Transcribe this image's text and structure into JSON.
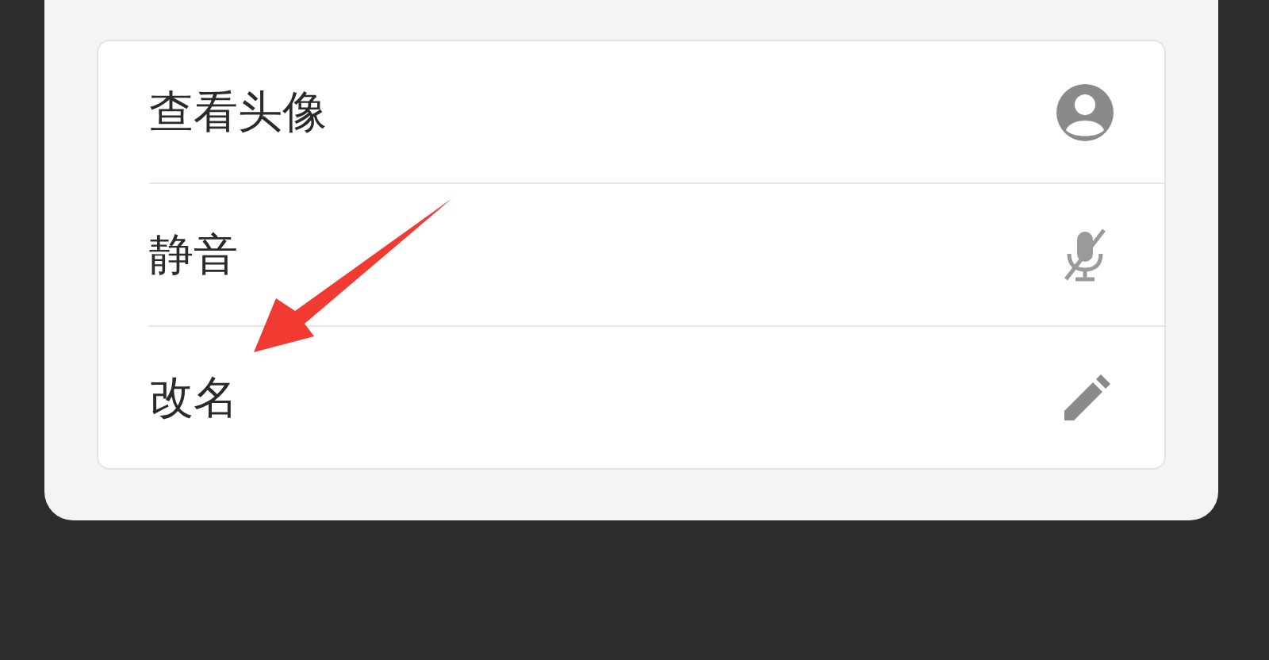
{
  "menu": {
    "items": [
      {
        "label": "查看头像",
        "kind": "avatar"
      },
      {
        "label": "静音",
        "kind": "mute"
      },
      {
        "label": "改名",
        "kind": "rename"
      }
    ]
  }
}
